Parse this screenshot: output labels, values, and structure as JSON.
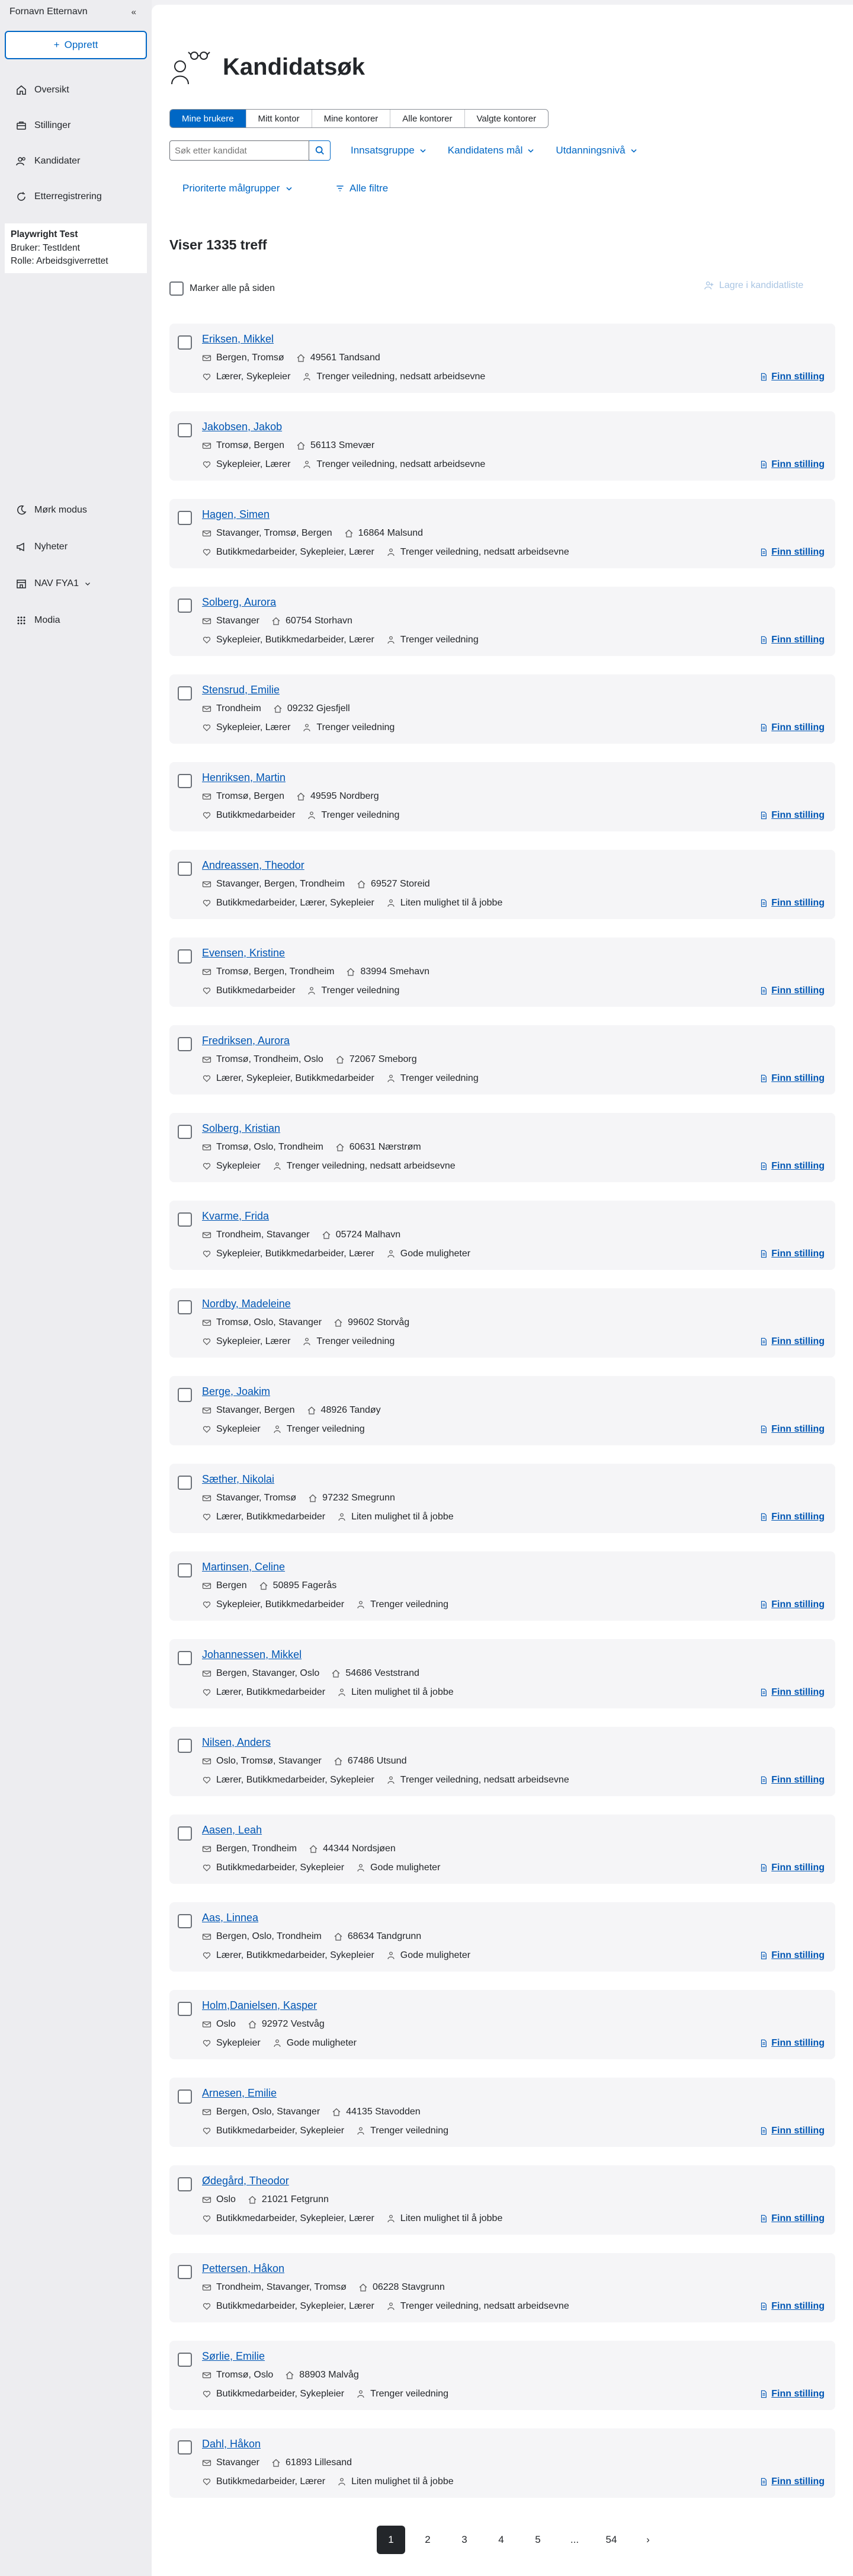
{
  "sidebar": {
    "user_name": "Fornavn Etternavn",
    "collapse": "«",
    "create_label": "Opprett",
    "items": [
      {
        "label": "Oversikt",
        "icon": "home-icon"
      },
      {
        "label": "Stillinger",
        "icon": "briefcase-icon"
      },
      {
        "label": "Kandidater",
        "icon": "people-icon"
      },
      {
        "label": "Etterregistrering",
        "icon": "refresh-icon"
      }
    ],
    "info": {
      "title": "Playwright Test",
      "user": "Bruker: TestIdent",
      "role": "Rolle: Arbeidsgiverrettet"
    },
    "bottom": [
      {
        "label": "Mørk modus",
        "icon": "moon-icon"
      },
      {
        "label": "Nyheter",
        "icon": "megaphone-icon"
      },
      {
        "label": "NAV FYA1",
        "icon": "office-icon"
      },
      {
        "label": "Modia",
        "icon": "grid-icon"
      }
    ]
  },
  "header": {
    "title": "Kandidatsøk"
  },
  "toggle": [
    "Mine brukere",
    "Mitt kontor",
    "Mine kontorer",
    "Alle kontorer",
    "Valgte kontorer"
  ],
  "search": {
    "placeholder": "Søk etter kandidat"
  },
  "filters": [
    "Innsatsgruppe",
    "Kandidatens mål",
    "Utdanningsnivå"
  ],
  "filter_prioritized": "Prioriterte målgrupper",
  "filter_all": "Alle filtre",
  "count_label": "Viser 1335 treff",
  "mark_all": "Marker alle på siden",
  "save_list": "Lagre i kandidatliste",
  "finn_label": "Finn stilling",
  "candidates": [
    {
      "name": "Eriksen, Mikkel",
      "places": "Bergen, Tromsø",
      "address": "49561 Tandsand",
      "jobs": "Lærer, Sykepleier",
      "need": "Trenger veiledning, nedsatt arbeidsevne"
    },
    {
      "name": "Jakobsen, Jakob",
      "places": "Tromsø, Bergen",
      "address": "56113 Smevær",
      "jobs": "Sykepleier, Lærer",
      "need": "Trenger veiledning, nedsatt arbeidsevne"
    },
    {
      "name": "Hagen, Simen",
      "places": "Stavanger, Tromsø, Bergen",
      "address": "16864 Malsund",
      "jobs": "Butikkmedarbeider, Sykepleier, Lærer",
      "need": "Trenger veiledning, nedsatt arbeidsevne"
    },
    {
      "name": "Solberg, Aurora",
      "places": "Stavanger",
      "address": "60754 Storhavn",
      "jobs": "Sykepleier, Butikkmedarbeider, Lærer",
      "need": "Trenger veiledning"
    },
    {
      "name": "Stensrud, Emilie",
      "places": "Trondheim",
      "address": "09232 Gjesfjell",
      "jobs": "Sykepleier, Lærer",
      "need": "Trenger veiledning"
    },
    {
      "name": "Henriksen, Martin",
      "places": "Tromsø, Bergen",
      "address": "49595 Nordberg",
      "jobs": "Butikkmedarbeider",
      "need": "Trenger veiledning"
    },
    {
      "name": "Andreassen, Theodor",
      "places": "Stavanger, Bergen, Trondheim",
      "address": "69527 Storeid",
      "jobs": "Butikkmedarbeider, Lærer, Sykepleier",
      "need": "Liten mulighet til å jobbe"
    },
    {
      "name": "Evensen, Kristine",
      "places": "Tromsø, Bergen, Trondheim",
      "address": "83994 Smehavn",
      "jobs": "Butikkmedarbeider",
      "need": "Trenger veiledning"
    },
    {
      "name": "Fredriksen, Aurora",
      "places": "Tromsø, Trondheim, Oslo",
      "address": "72067 Smeborg",
      "jobs": "Lærer, Sykepleier, Butikkmedarbeider",
      "need": "Trenger veiledning"
    },
    {
      "name": "Solberg, Kristian",
      "places": "Tromsø, Oslo, Trondheim",
      "address": "60631 Nærstrøm",
      "jobs": "Sykepleier",
      "need": "Trenger veiledning, nedsatt arbeidsevne"
    },
    {
      "name": "Kvarme, Frida",
      "places": "Trondheim, Stavanger",
      "address": "05724 Malhavn",
      "jobs": "Sykepleier, Butikkmedarbeider, Lærer",
      "need": "Gode muligheter"
    },
    {
      "name": "Nordby, Madeleine",
      "places": "Tromsø, Oslo, Stavanger",
      "address": "99602 Storvåg",
      "jobs": "Sykepleier, Lærer",
      "need": "Trenger veiledning"
    },
    {
      "name": "Berge, Joakim",
      "places": "Stavanger, Bergen",
      "address": "48926 Tandøy",
      "jobs": "Sykepleier",
      "need": "Trenger veiledning"
    },
    {
      "name": "Sæther, Nikolai",
      "places": "Stavanger, Tromsø",
      "address": "97232 Smegrunn",
      "jobs": "Lærer, Butikkmedarbeider",
      "need": "Liten mulighet til å jobbe"
    },
    {
      "name": "Martinsen, Celine",
      "places": "Bergen",
      "address": "50895 Fagerås",
      "jobs": "Sykepleier, Butikkmedarbeider",
      "need": "Trenger veiledning"
    },
    {
      "name": "Johannessen, Mikkel",
      "places": "Bergen, Stavanger, Oslo",
      "address": "54686 Veststrand",
      "jobs": "Lærer, Butikkmedarbeider",
      "need": "Liten mulighet til å jobbe"
    },
    {
      "name": "Nilsen, Anders",
      "places": "Oslo, Tromsø, Stavanger",
      "address": "67486 Utsund",
      "jobs": "Lærer, Butikkmedarbeider, Sykepleier",
      "need": "Trenger veiledning, nedsatt arbeidsevne"
    },
    {
      "name": "Aasen, Leah",
      "places": "Bergen, Trondheim",
      "address": "44344 Nordsjøen",
      "jobs": "Butikkmedarbeider, Sykepleier",
      "need": "Gode muligheter"
    },
    {
      "name": "Aas, Linnea",
      "places": "Bergen, Oslo, Trondheim",
      "address": "68634 Tandgrunn",
      "jobs": "Lærer, Butikkmedarbeider, Sykepleier",
      "need": "Gode muligheter"
    },
    {
      "name": "Holm,Danielsen, Kasper",
      "places": "Oslo",
      "address": "92972 Vestvåg",
      "jobs": "Sykepleier",
      "need": "Gode muligheter"
    },
    {
      "name": "Arnesen, Emilie",
      "places": "Bergen, Oslo, Stavanger",
      "address": "44135 Stavodden",
      "jobs": "Butikkmedarbeider, Sykepleier",
      "need": "Trenger veiledning"
    },
    {
      "name": "Ødegård, Theodor",
      "places": "Oslo",
      "address": "21021 Fetgrunn",
      "jobs": "Butikkmedarbeider, Sykepleier, Lærer",
      "need": "Liten mulighet til å jobbe"
    },
    {
      "name": "Pettersen, Håkon",
      "places": "Trondheim, Stavanger, Tromsø",
      "address": "06228 Stavgrunn",
      "jobs": "Butikkmedarbeider, Sykepleier, Lærer",
      "need": "Trenger veiledning, nedsatt arbeidsevne"
    },
    {
      "name": "Sørlie, Emilie",
      "places": "Tromsø, Oslo",
      "address": "88903 Malvåg",
      "jobs": "Butikkmedarbeider, Sykepleier",
      "need": "Trenger veiledning"
    },
    {
      "name": "Dahl, Håkon",
      "places": "Stavanger",
      "address": "61893 Lillesand",
      "jobs": "Butikkmedarbeider, Lærer",
      "need": "Liten mulighet til å jobbe"
    }
  ],
  "pagination": {
    "pages": [
      "1",
      "2",
      "3",
      "4",
      "5",
      "...",
      "54"
    ],
    "current": "1",
    "next": "›"
  }
}
